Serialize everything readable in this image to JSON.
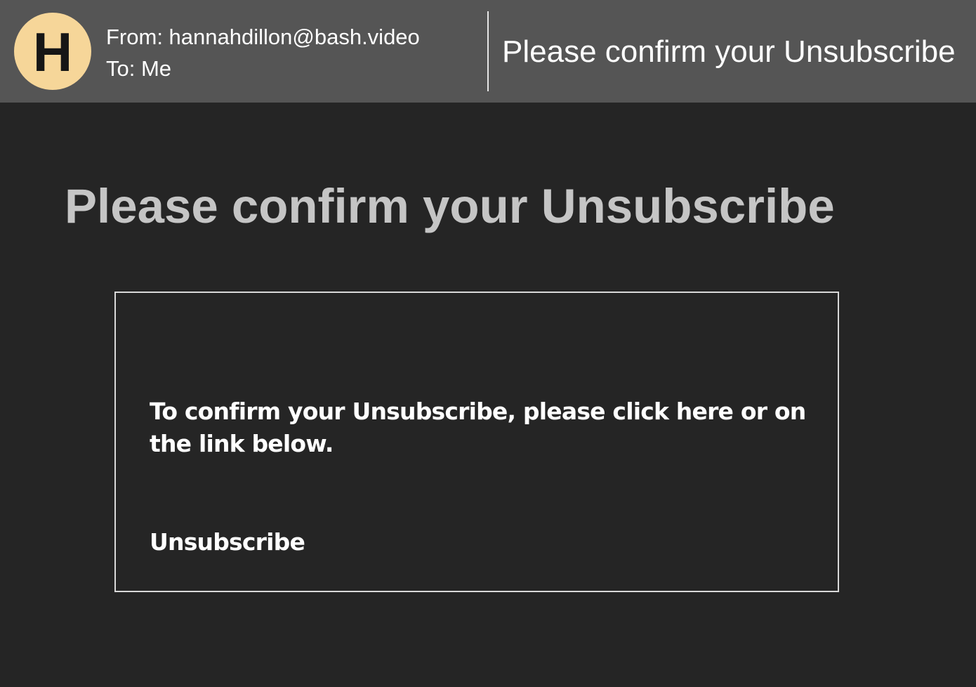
{
  "header": {
    "avatar_letter": "H",
    "from": "From: hannahdillon@bash.video",
    "to": "To: Me",
    "subject": "Please confirm your Unsubscribe"
  },
  "body": {
    "title": "Please confirm your Unsubscribe",
    "message": "To confirm your Unsubscribe, please click here or on the link below.",
    "link_label": "Unsubscribe"
  },
  "colors": {
    "header_bg": "#555555",
    "body_bg": "#252525",
    "avatar_bg": "#f6d699",
    "title_text": "#c5c5c5"
  }
}
